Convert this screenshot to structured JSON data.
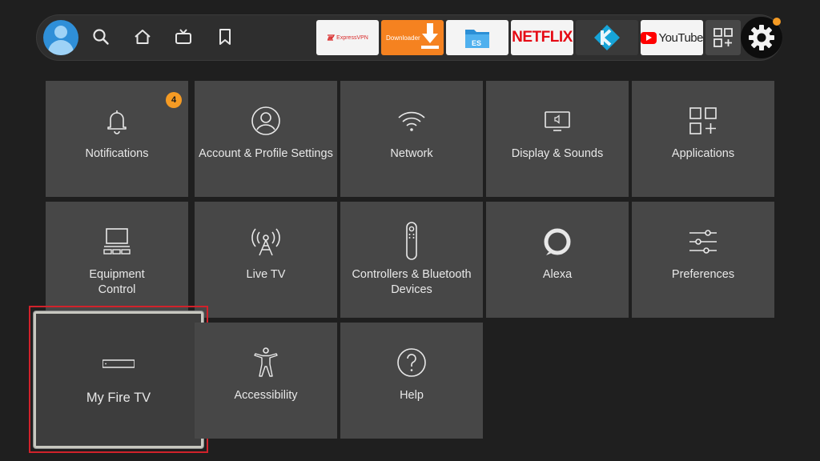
{
  "topbar": {
    "apps": [
      {
        "id": "expressvpn",
        "label": "ExpressVPN"
      },
      {
        "id": "downloader",
        "label": "Downloader"
      },
      {
        "id": "es-file-explorer",
        "label": ""
      },
      {
        "id": "netflix",
        "label": "NETFLIX"
      },
      {
        "id": "kodi",
        "label": ""
      },
      {
        "id": "youtube",
        "label": "YouTube"
      }
    ],
    "nav_icons": [
      "search-icon",
      "home-icon",
      "live-tv-icon",
      "bookmark-icon"
    ],
    "settings_icon": "gear-icon"
  },
  "settings": {
    "tiles": [
      {
        "label": "Notifications",
        "icon": "bell-icon",
        "badge": "4"
      },
      {
        "label": "Account & Profile Settings",
        "icon": "profile-icon"
      },
      {
        "label": "Network",
        "icon": "wifi-icon"
      },
      {
        "label": "Display & Sounds",
        "icon": "display-icon"
      },
      {
        "label": "Applications",
        "icon": "apps-icon"
      },
      {
        "label": "Equipment Control",
        "icon": "tv-equipment-icon"
      },
      {
        "label": "Live TV",
        "icon": "antenna-icon"
      },
      {
        "label": "Controllers & Bluetooth Devices",
        "icon": "remote-icon"
      },
      {
        "label": "Alexa",
        "icon": "alexa-icon"
      },
      {
        "label": "Preferences",
        "icon": "sliders-icon"
      },
      {
        "label": "My Fire TV",
        "icon": "fire-tv-device-icon",
        "focused": true
      },
      {
        "label": "Accessibility",
        "icon": "accessibility-icon"
      },
      {
        "label": "Help",
        "icon": "help-icon"
      }
    ]
  },
  "colors": {
    "background": "#1f1f1f",
    "tile": "#474747",
    "badge": "#f59b24",
    "focus_highlight": "#d1222b"
  }
}
